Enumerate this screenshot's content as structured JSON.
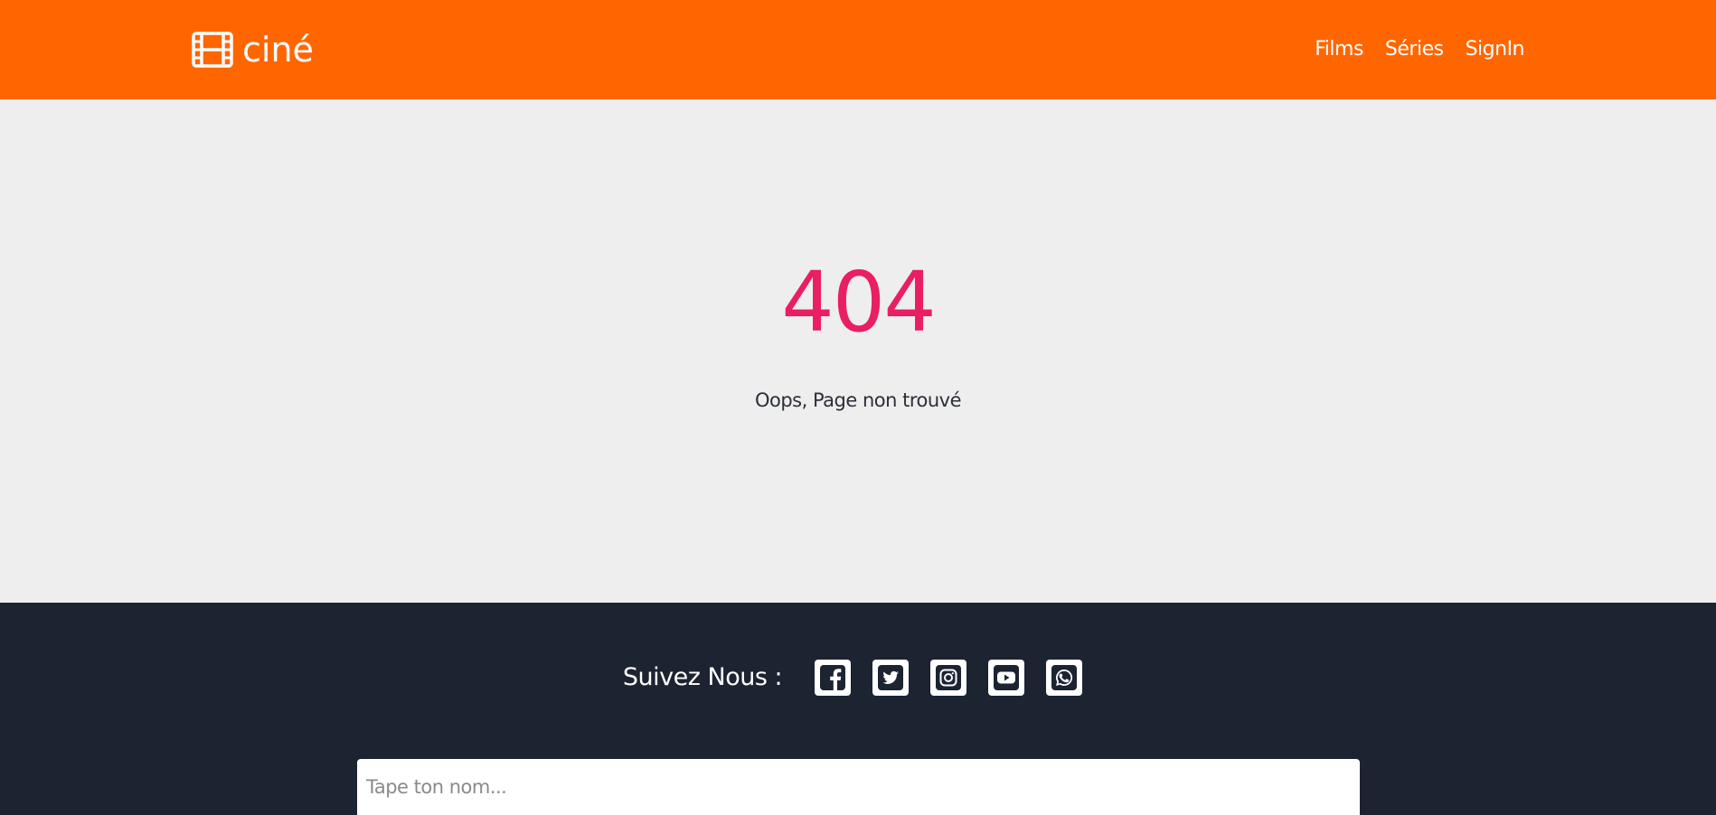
{
  "header": {
    "logo_text": "ciné",
    "logo_icon": "film-icon",
    "nav": [
      "Films",
      "Séries",
      "SignIn"
    ]
  },
  "main": {
    "code": "404",
    "message": "Oops, Page non trouvé"
  },
  "footer": {
    "follow_label": "Suivez Nous :",
    "social": [
      "facebook-icon",
      "twitter-icon",
      "instagram-icon",
      "youtube-icon",
      "whatsapp-icon"
    ],
    "name_placeholder": "Tape ton nom..."
  },
  "colors": {
    "header_bg": "#ff6600",
    "accent": "#e91e63",
    "footer_bg": "#1c2331",
    "main_bg": "#eeeeee"
  }
}
